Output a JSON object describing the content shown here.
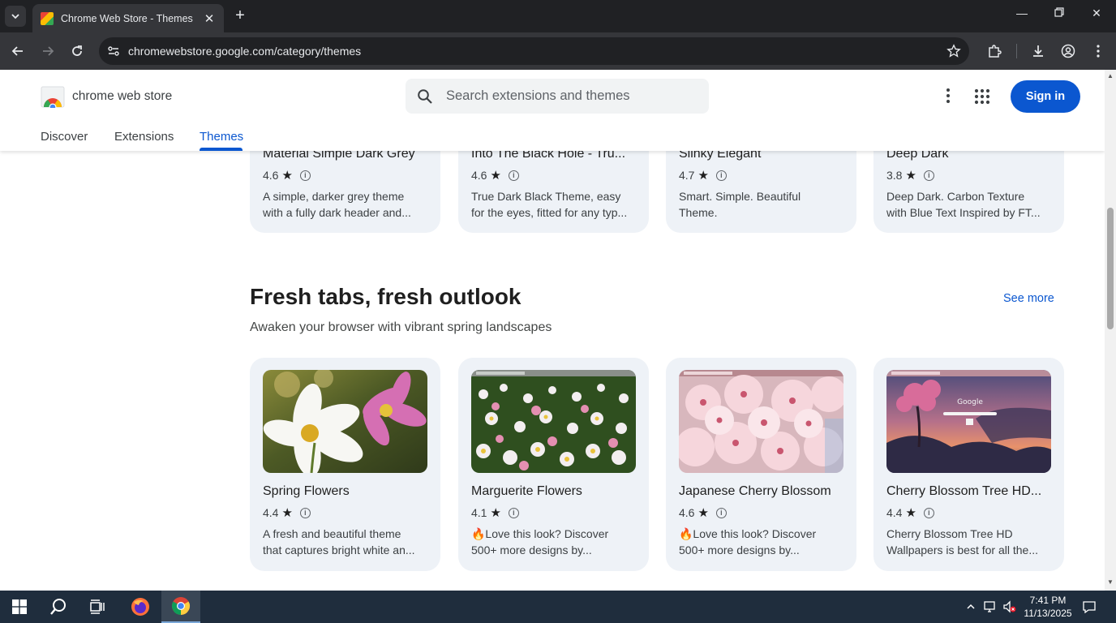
{
  "browser": {
    "tab_title": "Chrome Web Store - Themes",
    "url": "chromewebstore.google.com/category/themes"
  },
  "store": {
    "brand": "chrome web store",
    "search_placeholder": "Search extensions and themes",
    "signin_label": "Sign in",
    "nav": [
      "Discover",
      "Extensions",
      "Themes"
    ],
    "active_nav": "Themes"
  },
  "top_row": [
    {
      "title": "Material Simple Dark Grey",
      "rating": "4.6",
      "desc": [
        "A simple, darker grey theme",
        "with a fully dark header and..."
      ]
    },
    {
      "title": "Into The Black Hole - Tru...",
      "rating": "4.6",
      "desc": [
        "True Dark Black Theme, easy",
        "for the eyes, fitted for any typ..."
      ]
    },
    {
      "title": "Slinky Elegant",
      "rating": "4.7",
      "desc": [
        "Smart. Simple. Beautiful",
        "Theme."
      ]
    },
    {
      "title": "Deep Dark",
      "rating": "3.8",
      "desc": [
        "Deep Dark. Carbon Texture",
        "with Blue Text Inspired by FT..."
      ]
    }
  ],
  "section": {
    "title": "Fresh tabs, fresh outlook",
    "subtitle": "Awaken your browser with vibrant spring landscapes",
    "see_more": "See more",
    "cards": [
      {
        "title": "Spring Flowers",
        "rating": "4.4",
        "desc": [
          "A fresh and beautiful theme",
          "that captures bright white an..."
        ],
        "image": "white-cosmos-flower"
      },
      {
        "title": "Marguerite Flowers",
        "rating": "4.1",
        "desc": [
          "🔥Love this look? Discover",
          "500+ more designs by..."
        ],
        "image": "daisy-field"
      },
      {
        "title": "Japanese Cherry Blossom",
        "rating": "4.6",
        "desc": [
          "🔥Love this look? Discover",
          "500+ more designs by..."
        ],
        "image": "pink-cherry-blossom"
      },
      {
        "title": "Cherry Blossom Tree HD...",
        "rating": "4.4",
        "desc": [
          "Cherry Blossom Tree HD",
          "Wallpapers is best for all the..."
        ],
        "image": "cherry-tree-sunset",
        "image_text": "Google"
      }
    ]
  },
  "taskbar": {
    "time": "7:41 PM",
    "date": "11/13/2025"
  },
  "colors": {
    "accent": "#0b57d0",
    "card_bg": "#eef2f7",
    "chrome_dark": "#202124",
    "chrome_toolbar": "#35363a",
    "taskbar": "#1f2d3d"
  }
}
